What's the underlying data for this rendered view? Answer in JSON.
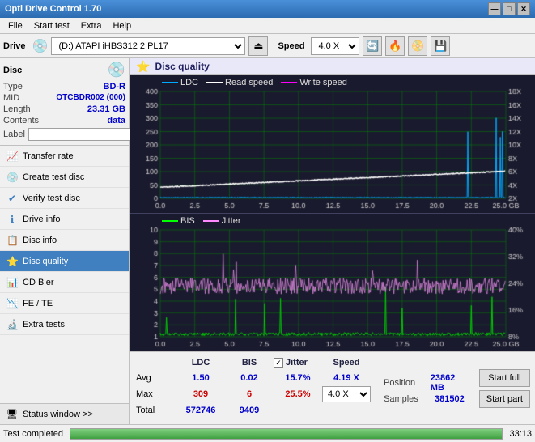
{
  "app": {
    "title": "Opti Drive Control 1.70",
    "title_icon": "💿"
  },
  "title_buttons": {
    "minimize": "—",
    "maximize": "□",
    "close": "✕"
  },
  "menu": {
    "items": [
      "File",
      "Start test",
      "Extra",
      "Help"
    ]
  },
  "drive_toolbar": {
    "drive_label": "Drive",
    "drive_value": "(D:) ATAPI iHBS312  2 PL17",
    "speed_label": "Speed",
    "speed_value": "4.0 X",
    "eject_icon": "⏏",
    "icon1": "🔄",
    "icon2": "💾",
    "icon3": "📀",
    "icon4": "💾"
  },
  "disc_panel": {
    "title": "Disc",
    "rows": [
      {
        "key": "Type",
        "val": "BD-R",
        "blue": true
      },
      {
        "key": "MID",
        "val": "OTCBDR002 (000)",
        "blue": true
      },
      {
        "key": "Length",
        "val": "23.31 GB",
        "blue": false
      },
      {
        "key": "Contents",
        "val": "data",
        "blue": true
      }
    ],
    "label_key": "Label",
    "label_placeholder": ""
  },
  "sidebar_menu": [
    {
      "id": "transfer-rate",
      "label": "Transfer rate",
      "icon": "📈"
    },
    {
      "id": "create-test-disc",
      "label": "Create test disc",
      "icon": "💿"
    },
    {
      "id": "verify-test-disc",
      "label": "Verify test disc",
      "icon": "✔"
    },
    {
      "id": "drive-info",
      "label": "Drive info",
      "icon": "ℹ"
    },
    {
      "id": "disc-info",
      "label": "Disc info",
      "icon": "📋"
    },
    {
      "id": "disc-quality",
      "label": "Disc quality",
      "icon": "⭐",
      "active": true
    },
    {
      "id": "cd-bler",
      "label": "CD Bler",
      "icon": "📊"
    },
    {
      "id": "fe-te",
      "label": "FE / TE",
      "icon": "📉"
    },
    {
      "id": "extra-tests",
      "label": "Extra tests",
      "icon": "🔬"
    }
  ],
  "status_window": {
    "label": "Status window >>",
    "icon": "🖥"
  },
  "disc_quality": {
    "title": "Disc quality",
    "icon": "⭐",
    "chart1": {
      "legend": [
        {
          "label": "LDC",
          "color": "#00aaff"
        },
        {
          "label": "Read speed",
          "color": "#ffffff"
        },
        {
          "label": "Write speed",
          "color": "#ff00ff"
        }
      ],
      "y_max": 400,
      "y_labels": [
        400,
        350,
        300,
        250,
        200,
        150,
        100,
        50
      ],
      "y2_labels": [
        "18X",
        "16X",
        "14X",
        "12X",
        "10X",
        "8X",
        "6X",
        "4X",
        "2X"
      ],
      "x_labels": [
        0.0,
        2.5,
        5.0,
        7.5,
        10.0,
        12.5,
        15.0,
        17.5,
        20.0,
        22.5,
        "25.0 GB"
      ]
    },
    "chart2": {
      "legend": [
        {
          "label": "BIS",
          "color": "#00ff00"
        },
        {
          "label": "Jitter",
          "color": "#ff88ff"
        }
      ],
      "y_labels": [
        10,
        9,
        8,
        7,
        6,
        5,
        4,
        3,
        2,
        1
      ],
      "y2_labels": [
        "40%",
        "32%",
        "24%",
        "16%",
        "8%"
      ],
      "x_labels": [
        0.0,
        2.5,
        5.0,
        7.5,
        10.0,
        12.5,
        15.0,
        17.5,
        20.0,
        22.5,
        "25.0 GB"
      ]
    }
  },
  "stats": {
    "headers": [
      "LDC",
      "BIS",
      "",
      "Jitter",
      "Speed"
    ],
    "avg_label": "Avg",
    "max_label": "Max",
    "total_label": "Total",
    "ldc_avg": "1.50",
    "ldc_max": "309",
    "ldc_total": "572746",
    "bis_avg": "0.02",
    "bis_max": "6",
    "bis_total": "9409",
    "jitter_avg": "15.7%",
    "jitter_max": "25.5%",
    "jitter_total": "",
    "speed_label": "Speed",
    "speed_val": "4.19 X",
    "speed_dropdown": "4.0 X",
    "position_label": "Position",
    "position_val": "23862 MB",
    "samples_label": "Samples",
    "samples_val": "381502",
    "jitter_checked": true,
    "jitter_label": "Jitter"
  },
  "action_buttons": {
    "start_full": "Start full",
    "start_part": "Start part"
  },
  "status_bar": {
    "text": "Test completed",
    "progress": 100,
    "time": "33:13"
  }
}
